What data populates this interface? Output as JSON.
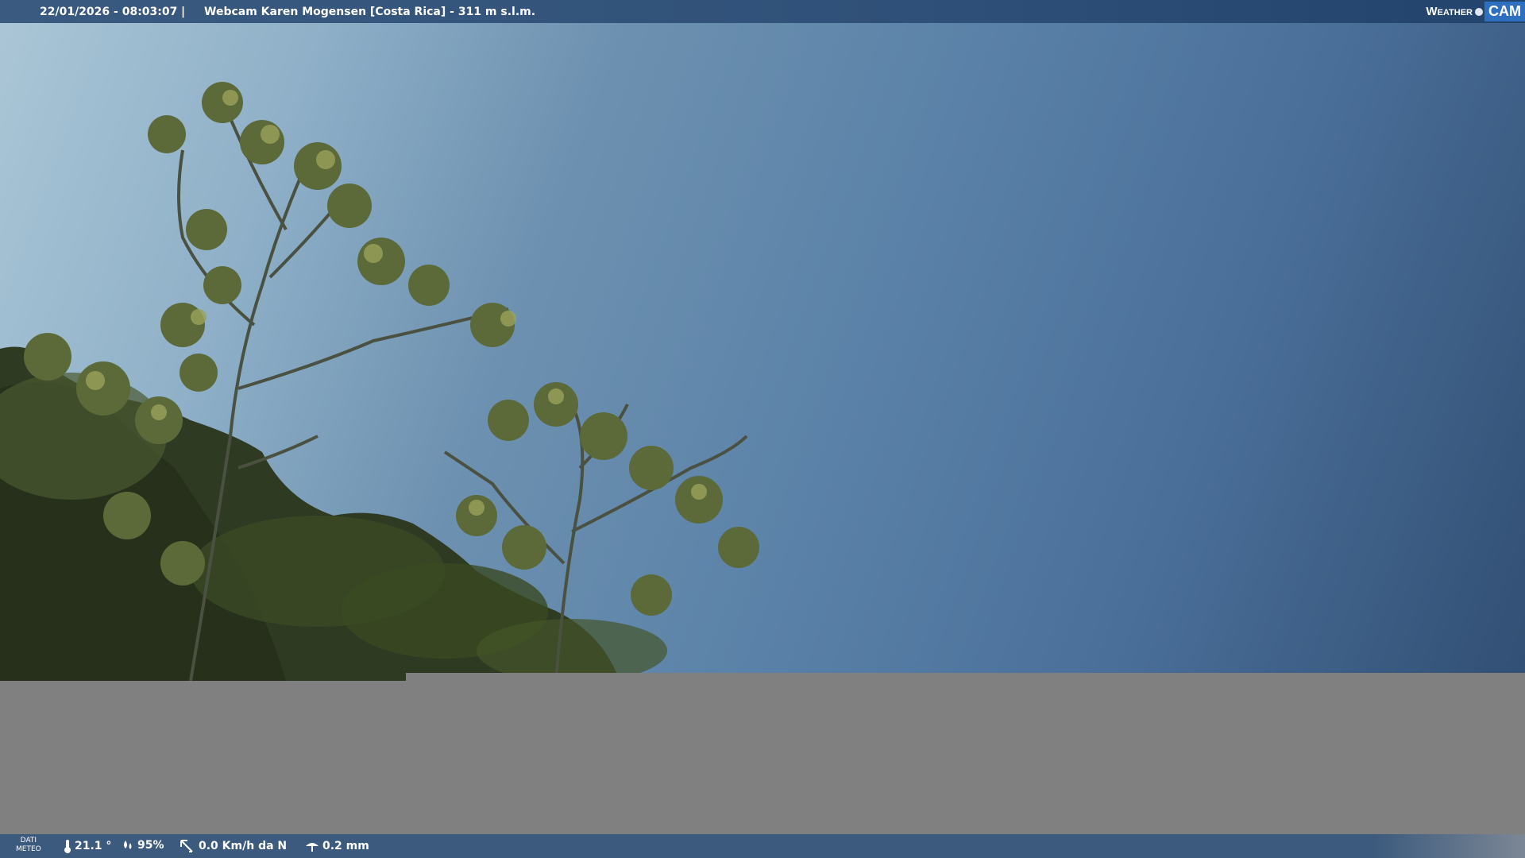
{
  "header": {
    "datetime": "22/01/2026 - 08:03:07",
    "separator": "|",
    "title": "Webcam Karen Mogensen [Costa Rica] - 311 m s.l.m."
  },
  "logo": {
    "weather": "Weather",
    "cam": "CAM"
  },
  "footer": {
    "dati_line1": "DATI",
    "dati_line2": "METEO",
    "temperature": "21.1 °",
    "humidity": "95%",
    "wind": "0.0 Km/h da N",
    "rain": "0.2 mm"
  }
}
